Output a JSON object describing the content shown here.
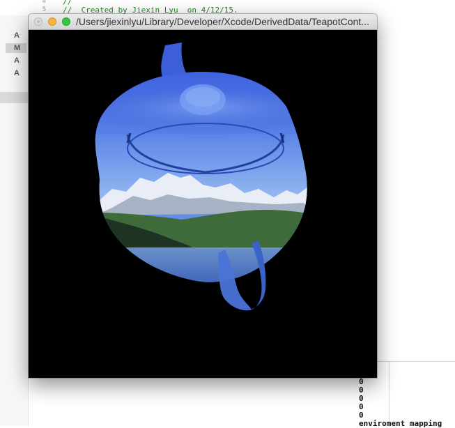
{
  "editor": {
    "lines": [
      {
        "number": "4",
        "text": "//"
      },
      {
        "number": "5",
        "text": "//  Created by Jiexin Lyu  on 4/12/15."
      }
    ]
  },
  "source_control_status": [
    "A",
    "M",
    "A",
    "A"
  ],
  "console": {
    "lines": [
      "0",
      "0",
      "0",
      "0",
      "0",
      "enviroment mapping"
    ]
  },
  "gl_window": {
    "title": "/Users/jiexinlyu/Library/Developer/Xcode/DerivedData/TeapotCont...",
    "scene": "environment-mapped teapot"
  },
  "colors": {
    "window_background": "#000000",
    "close_button": "#dcdcdc",
    "minimize_button": "#f5b43a",
    "zoom_button": "#36c544",
    "comment_green": "#1f8a1f"
  }
}
